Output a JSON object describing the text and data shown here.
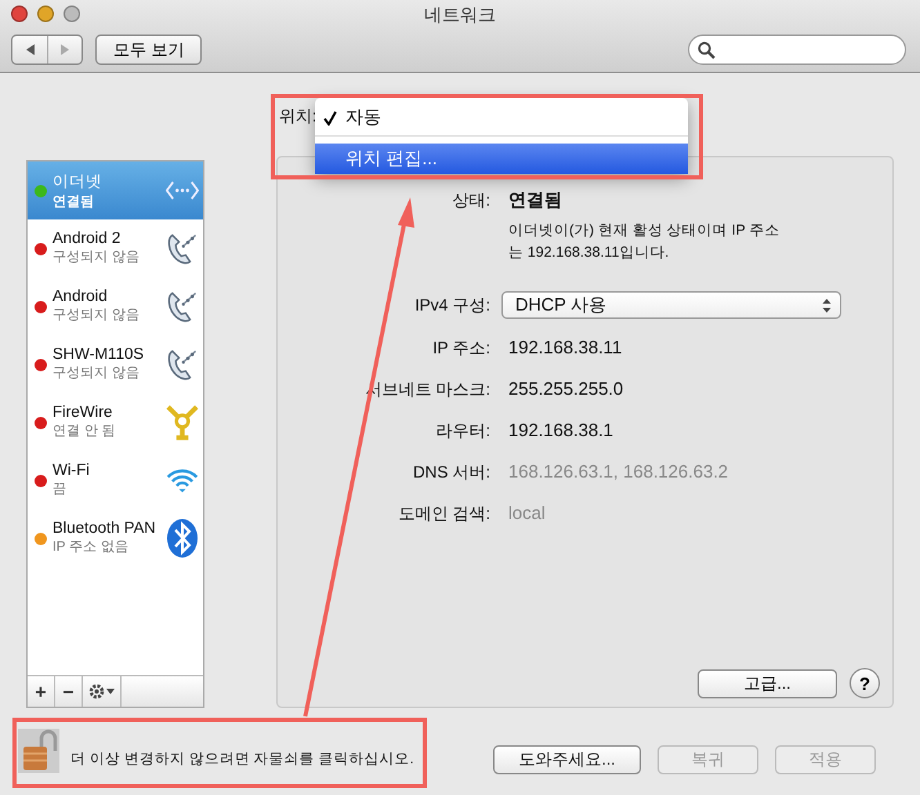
{
  "window": {
    "title": "네트워크"
  },
  "toolbar": {
    "show_all": "모두 보기"
  },
  "location": {
    "label": "위치:",
    "menu": [
      {
        "label": "자동",
        "checked": true,
        "selected": false
      },
      {
        "label": "위치 편집...",
        "checked": false,
        "selected": true
      }
    ]
  },
  "services": [
    {
      "name": "이더넷",
      "status": "연결됨",
      "color": "#3cb81c",
      "selected": true,
      "kind": "ethernet"
    },
    {
      "name": "Android 2",
      "status": "구성되지 않음",
      "color": "#d81c1c",
      "selected": false,
      "kind": "phone"
    },
    {
      "name": "Android",
      "status": "구성되지 않음",
      "color": "#d81c1c",
      "selected": false,
      "kind": "phone"
    },
    {
      "name": "SHW-M110S",
      "status": "구성되지 않음",
      "color": "#d81c1c",
      "selected": false,
      "kind": "phone"
    },
    {
      "name": "FireWire",
      "status": "연결 안 됨",
      "color": "#d81c1c",
      "selected": false,
      "kind": "firewire"
    },
    {
      "name": "Wi-Fi",
      "status": "끔",
      "color": "#d81c1c",
      "selected": false,
      "kind": "wifi"
    },
    {
      "name": "Bluetooth PAN",
      "status": "IP 주소 없음",
      "color": "#f0961e",
      "selected": false,
      "kind": "bluetooth"
    }
  ],
  "sidebar_toolbar": {
    "add": "+",
    "remove": "−"
  },
  "details": {
    "status_label": "상태:",
    "status_value": "연결됨",
    "status_description": "이더넷이(가) 현재 활성 상태이며 IP 주소는 192.168.38.11입니다.",
    "ipv4_label": "IPv4 구성:",
    "ipv4_value": "DHCP 사용",
    "fields": [
      {
        "label": "IP 주소:",
        "value": "192.168.38.11",
        "dimmed": false
      },
      {
        "label": "서브네트 마스크:",
        "value": "255.255.255.0",
        "dimmed": false
      },
      {
        "label": "라우터:",
        "value": "192.168.38.1",
        "dimmed": false
      },
      {
        "label": "DNS 서버:",
        "value": "168.126.63.1, 168.126.63.2",
        "dimmed": true
      },
      {
        "label": "도메인 검색:",
        "value": "local",
        "dimmed": true
      }
    ],
    "advanced_button": "고급...",
    "help_button": "?"
  },
  "lock": {
    "text": "더 이상 변경하지 않으려면 자물쇠를 클릭하십시오."
  },
  "buttons": [
    {
      "label": "도와주세요...",
      "disabled": false
    },
    {
      "label": "복귀",
      "disabled": true
    },
    {
      "label": "적용",
      "disabled": true
    }
  ]
}
